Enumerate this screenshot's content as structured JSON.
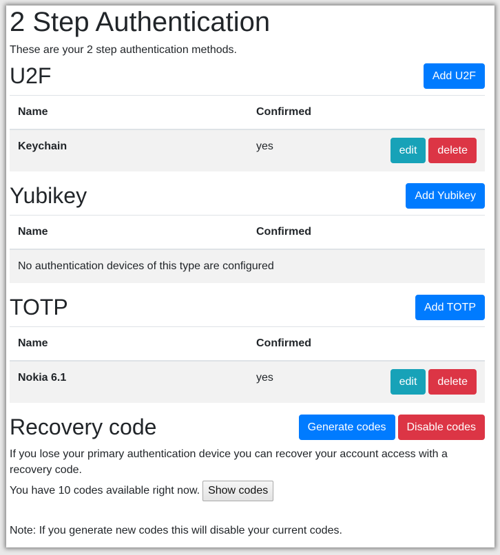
{
  "page": {
    "title": "2 Step Authentication",
    "intro": "These are your 2 step authentication methods."
  },
  "table_headers": {
    "name": "Name",
    "confirmed": "Confirmed"
  },
  "sections": {
    "u2f": {
      "heading": "U2F",
      "add_label": "Add U2F",
      "rows": [
        {
          "name": "Keychain",
          "confirmed": "yes",
          "edit_label": "edit",
          "delete_label": "delete"
        }
      ]
    },
    "yubikey": {
      "heading": "Yubikey",
      "add_label": "Add Yubikey",
      "empty_message": "No authentication devices of this type are configured"
    },
    "totp": {
      "heading": "TOTP",
      "add_label": "Add TOTP",
      "rows": [
        {
          "name": "Nokia 6.1",
          "confirmed": "yes",
          "edit_label": "edit",
          "delete_label": "delete"
        }
      ]
    }
  },
  "recovery": {
    "heading": "Recovery code",
    "generate_label": "Generate codes",
    "disable_label": "Disable codes",
    "description": "If you lose your primary authentication device you can recover your account access with a recovery code.",
    "codes_available_text": "You have 10 codes available right now.",
    "codes_available_count": 10,
    "show_codes_label": "Show codes",
    "note": "Note: If you generate new codes this will disable your current codes."
  },
  "colors": {
    "primary": "#007bff",
    "danger": "#dc3545",
    "info": "#17a2b8",
    "row_stripe": "#f2f2f2",
    "border": "#dee2e6"
  }
}
